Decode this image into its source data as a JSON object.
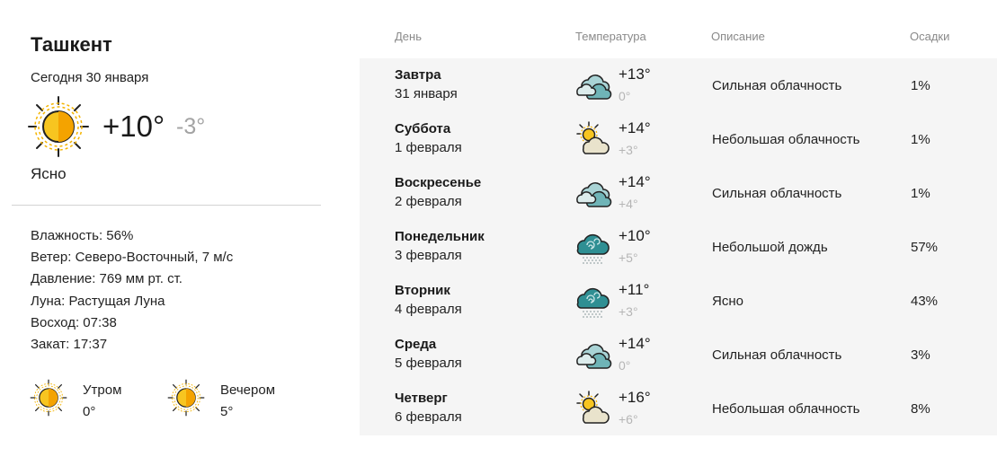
{
  "current": {
    "city": "Ташкент",
    "date": "Сегодня 30 января",
    "icon": "sun-icon",
    "temp": "+10°",
    "temp_night": "-3°",
    "condition": "Ясно",
    "details": {
      "humidity": "Влажность: 56%",
      "wind": "Ветер: Северо-Восточный, 7 м/с",
      "pressure": "Давление: 769 мм рт. ст.",
      "moon": "Луна: Растущая Луна",
      "sunrise": "Восход: 07:38",
      "sunset": "Закат: 17:37"
    },
    "morning": {
      "label": "Утром",
      "value": "0°",
      "icon": "sun-icon"
    },
    "evening": {
      "label": "Вечером",
      "value": "5°",
      "icon": "sun-icon"
    }
  },
  "table": {
    "headers": {
      "day": "День",
      "temp": "Температура",
      "desc": "Описание",
      "precip": "Осадки"
    },
    "rows": [
      {
        "day": "Завтра",
        "date": "31 января",
        "icon": "cloudy-icon",
        "temp_day": "+13°",
        "temp_night": "0°",
        "desc": "Сильная облачность",
        "precip": "1%"
      },
      {
        "day": "Суббота",
        "date": "1 февраля",
        "icon": "partly-cloudy-icon",
        "temp_day": "+14°",
        "temp_night": "+3°",
        "desc": "Небольшая облачность",
        "precip": "1%"
      },
      {
        "day": "Воскресенье",
        "date": "2 февраля",
        "icon": "cloudy-icon",
        "temp_day": "+14°",
        "temp_night": "+4°",
        "desc": "Сильная облачность",
        "precip": "1%"
      },
      {
        "day": "Понедельник",
        "date": "3 февраля",
        "icon": "rain-icon",
        "temp_day": "+10°",
        "temp_night": "+5°",
        "desc": "Небольшой дождь",
        "precip": "57%"
      },
      {
        "day": "Вторник",
        "date": "4 февраля",
        "icon": "rain-icon",
        "temp_day": "+11°",
        "temp_night": "+3°",
        "desc": "Ясно",
        "precip": "43%"
      },
      {
        "day": "Среда",
        "date": "5 февраля",
        "icon": "cloudy-icon",
        "temp_day": "+14°",
        "temp_night": "0°",
        "desc": "Сильная облачность",
        "precip": "3%"
      },
      {
        "day": "Четверг",
        "date": "6 февраля",
        "icon": "partly-cloudy-icon",
        "temp_day": "+16°",
        "temp_night": "+6°",
        "desc": "Небольшая облачность",
        "precip": "8%"
      }
    ]
  },
  "colors": {
    "sun_yellow": "#f7c520",
    "sun_orange": "#f4a300",
    "cloud_teal": "#8cc4c6",
    "cloud_dark": "#4a9ea1",
    "row_bg": "#f5f5f5"
  }
}
